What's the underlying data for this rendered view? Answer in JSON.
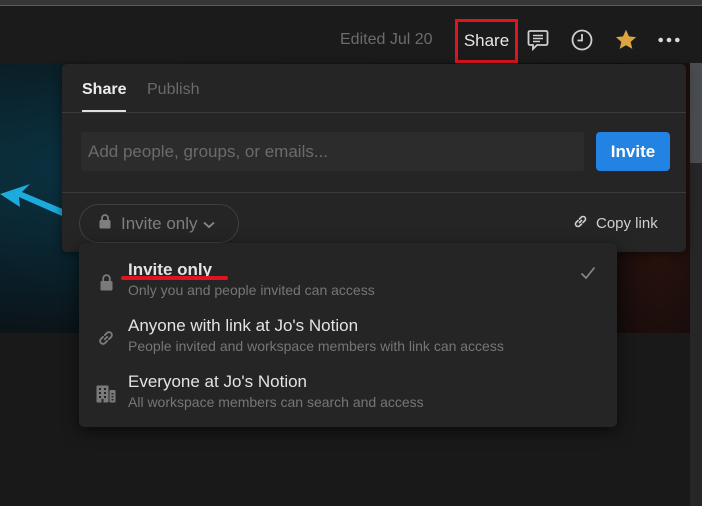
{
  "topbar": {
    "edited": "Edited Jul 20",
    "share_label": "Share",
    "icons": [
      "comment-icon",
      "clock-icon",
      "star-icon",
      "more-icon"
    ],
    "star_color": "#d9a441"
  },
  "share_panel": {
    "tabs": [
      {
        "label": "Share",
        "active": true
      },
      {
        "label": "Publish",
        "active": false
      }
    ],
    "invite_input": {
      "value": "",
      "placeholder": "Add people, groups, or emails..."
    },
    "invite_button": "Invite",
    "invite_button_color": "#2383e2",
    "access_selector": "Invite only",
    "copy_link": "Copy link"
  },
  "access_dropdown": {
    "options": [
      {
        "icon": "lock-icon",
        "title": "Invite only",
        "description": "Only you and people invited can access",
        "selected": true
      },
      {
        "icon": "link-icon",
        "title": "Anyone with link at Jo's Notion",
        "description": "People invited and workspace members with link can access",
        "selected": false
      },
      {
        "icon": "building-icon",
        "title": "Everyone at Jo's Notion",
        "description": "All workspace members can search and access",
        "selected": false
      }
    ]
  },
  "annotations": {
    "highlight_color": "#e0141e"
  }
}
